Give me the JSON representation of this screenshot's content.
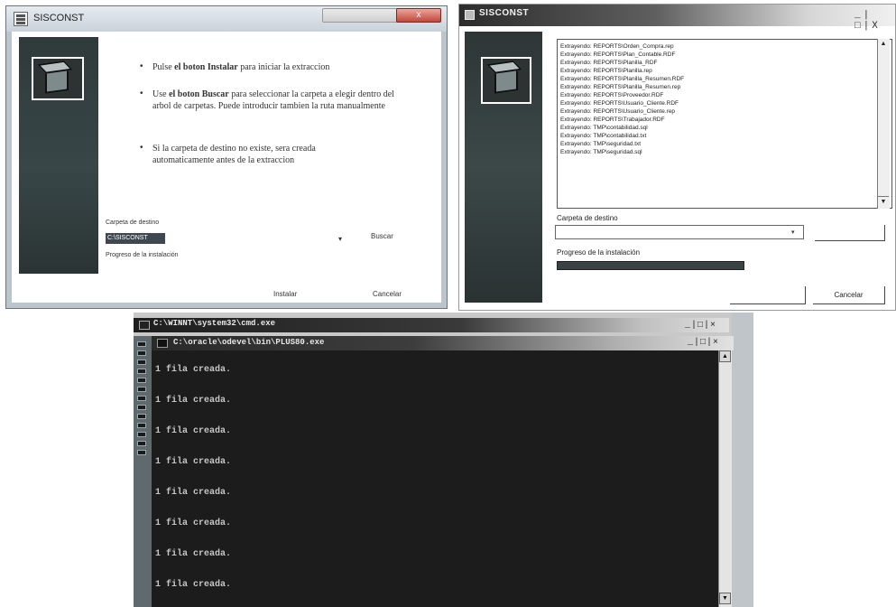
{
  "window1": {
    "title": "SISCONST",
    "close_glyph": "x",
    "bullets": [
      {
        "pre": "Pulse ",
        "bold": "el boton Instalar",
        "post": " para iniciar la extraccion"
      },
      {
        "pre": "Use ",
        "bold": "el boton Buscar",
        "post": " para seleccionar la carpeta a elegir dentro del arbol de carpetas. Puede introducir tambien la ruta manualmente"
      },
      {
        "pre": "",
        "bold": "",
        "post": "Si la carpeta de destino no existe, sera creada automaticamente antes de la extraccion"
      }
    ],
    "bullet_glyph": "•",
    "dest_label": "Carpeta de destino",
    "dest_value": "C:\\SISCONST",
    "dropdown_glyph": "▾",
    "buscar_label": "Buscar",
    "progress_label": "Progreso de la instalación",
    "instalar_label": "Instalar",
    "cancelar_label": "Cancelar"
  },
  "window2": {
    "title": "SISCONST",
    "controls": "_|□|X",
    "log_lines": [
      "Extrayendo: REPORTS\\Orden_Compra.rep",
      "Extrayendo: REPORTS\\Plan_Contable.RDF",
      "Extrayendo: REPORTS\\Planilla_RDF",
      "Extrayendo: REPORTS\\Planilla.rep",
      "Extrayendo: REPORTS\\Planilla_Resumen.RDF",
      "Extrayendo: REPORTS\\Planilla_Resumen.rep",
      "Extrayendo: REPORTS\\Proveedor.RDF",
      "Extrayendo: REPORTS\\Usuario_Cliente.RDF",
      "Extrayendo: REPORTS\\Usuario_Cliente.rep",
      "Extrayendo: REPORTS\\Trabajador.RDF",
      "Extrayendo: TMP\\contabilidad.sql",
      "Extrayendo: TMP\\contabilidad.txt",
      "Extrayendo: TMP\\seguridad.txt",
      "Extrayendo: TMP\\seguridad.sql"
    ],
    "scroll_up_glyph": "▲",
    "scroll_down_glyph": "▼",
    "dest_label": "Carpeta de destino",
    "dropdown_glyph": "▾",
    "progress_label": "Progreso de la instalación",
    "progress": 1.0,
    "cancel_label": "Cancelar"
  },
  "window3": {
    "outer_title": "C:\\WINNT\\system32\\cmd.exe",
    "outer_controls": "_|□|×",
    "inner_title": "C:\\oracle\\odevel\\bin\\PLUS80.exe",
    "inner_controls": "_|□|×",
    "lines": [
      "1 fila creada.",
      "1 fila creada.",
      "1 fila creada.",
      "1 fila creada.",
      "1 fila creada.",
      "1 fila creada.",
      "1 fila creada.",
      "1 fila creada."
    ],
    "scroll_up_glyph": "▲",
    "scroll_down_glyph": "▼"
  }
}
